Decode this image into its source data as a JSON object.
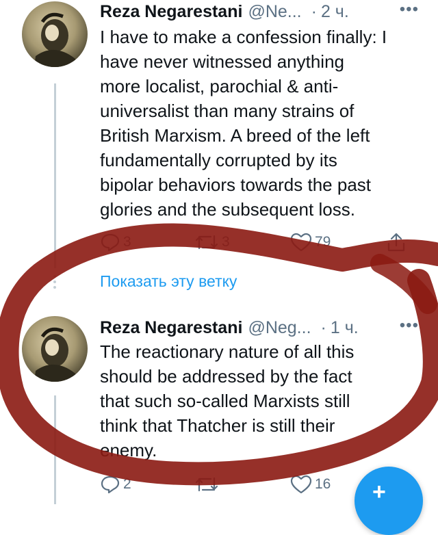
{
  "colors": {
    "accent": "#1d9bf0",
    "scribble": "#8b1a12",
    "muted": "#5b7083"
  },
  "tweet1": {
    "name": "Reza Negarestani",
    "handle": "@Ne...",
    "dot": "·",
    "time": "2 ч.",
    "more": "•••",
    "text": "I have to make a confession finally: I\nhave never witnessed anything\nmore localist, parochial & anti-\nuniversalist than many strains of\nBritish Marxism. A breed of the left\nfundamentally corrupted by its\nbipolar behaviors towards the past\nglories and the subsequent loss.",
    "replies": "3",
    "retweets": "3",
    "likes": "79"
  },
  "show_thread": "Показать эту ветку",
  "tweet2": {
    "name": "Reza Negarestani",
    "handle": "@Neg...",
    "dot": "·",
    "time": "1 ч.",
    "more": "•••",
    "text": "The reactionary nature of all this\nshould be addressed by the fact\nthat such so-called Marxists still\nthink that Thatcher is still their\nenemy.",
    "replies": "2",
    "retweets": "",
    "likes": "16"
  },
  "fab": {
    "icon": "compose-tweet-icon",
    "plus": "+"
  }
}
